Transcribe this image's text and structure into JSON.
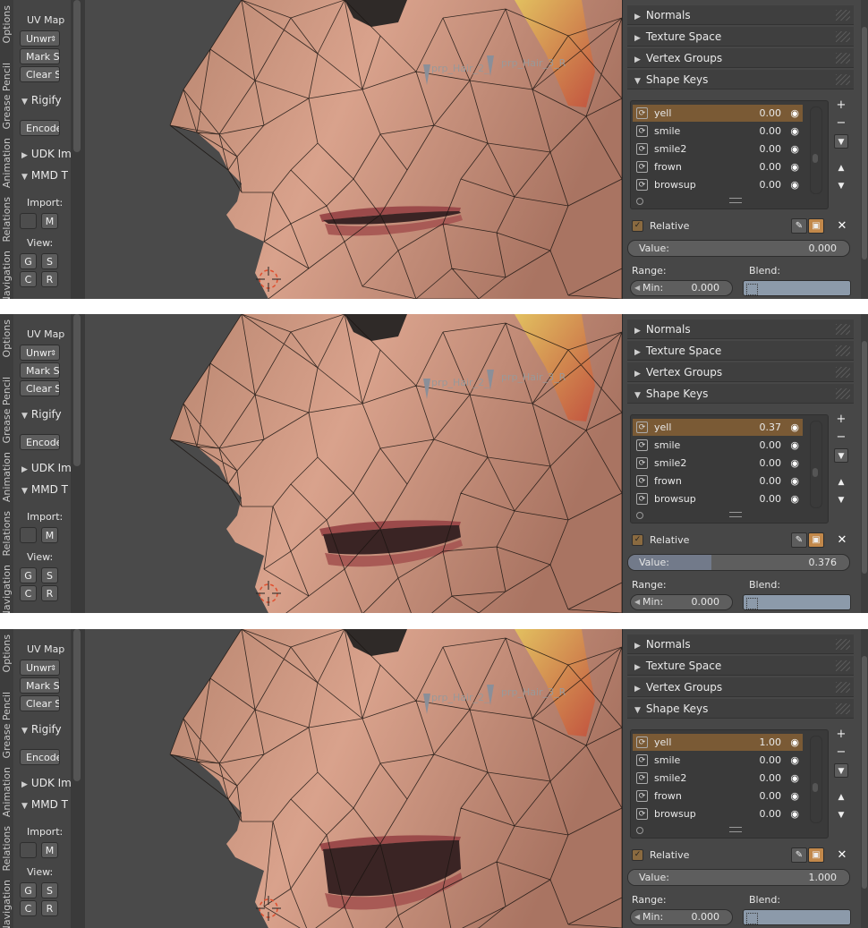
{
  "left_tabs": [
    "Options",
    "Grease Pencil",
    "Animation",
    "Relations",
    "Navigation"
  ],
  "tools": {
    "uv_map": "UV Map",
    "unwrap": "Unwr",
    "mark_seam": "Mark S",
    "clear_seam": "Clear S",
    "rigify": "Rigify",
    "encode": "Encode",
    "udk": "UDK Im",
    "mmd": "MMD T",
    "import_label": "Import:",
    "import_m": "M",
    "view_label": "View:",
    "g": "G",
    "s": "S",
    "c": "C",
    "r": "R"
  },
  "viewport": {
    "bone_label_1": "prp_Hair_2_",
    "bone_label_2": "prp_Hair_3_R"
  },
  "props": {
    "normals": "Normals",
    "texture_space": "Texture Space",
    "vertex_groups": "Vertex Groups",
    "shape_keys": "Shape Keys",
    "relative": "Relative",
    "value_label": "Value:",
    "range_label": "Range:",
    "blend_label": "Blend:",
    "min_label": "Min:",
    "min_value": "0.000",
    "add_btn": "+",
    "remove_btn": "−"
  },
  "frames": [
    {
      "keys": [
        {
          "name": "yell",
          "value": "0.00"
        },
        {
          "name": "smile",
          "value": "0.00"
        },
        {
          "name": "smile2",
          "value": "0.00"
        },
        {
          "name": "frown",
          "value": "0.00"
        },
        {
          "name": "browsup",
          "value": "0.00"
        }
      ],
      "value_text": "0.000",
      "value_fraction": 0.0,
      "jaw_open": 0.0
    },
    {
      "keys": [
        {
          "name": "yell",
          "value": "0.37"
        },
        {
          "name": "smile",
          "value": "0.00"
        },
        {
          "name": "smile2",
          "value": "0.00"
        },
        {
          "name": "frown",
          "value": "0.00"
        },
        {
          "name": "browsup",
          "value": "0.00"
        }
      ],
      "value_text": "0.376",
      "value_fraction": 0.376,
      "jaw_open": 0.376
    },
    {
      "keys": [
        {
          "name": "yell",
          "value": "1.00"
        },
        {
          "name": "smile",
          "value": "0.00"
        },
        {
          "name": "smile2",
          "value": "0.00"
        },
        {
          "name": "frown",
          "value": "0.00"
        },
        {
          "name": "browsup",
          "value": "0.00"
        }
      ],
      "value_text": "1.000",
      "value_fraction": 1.0,
      "jaw_open": 1.0
    }
  ]
}
